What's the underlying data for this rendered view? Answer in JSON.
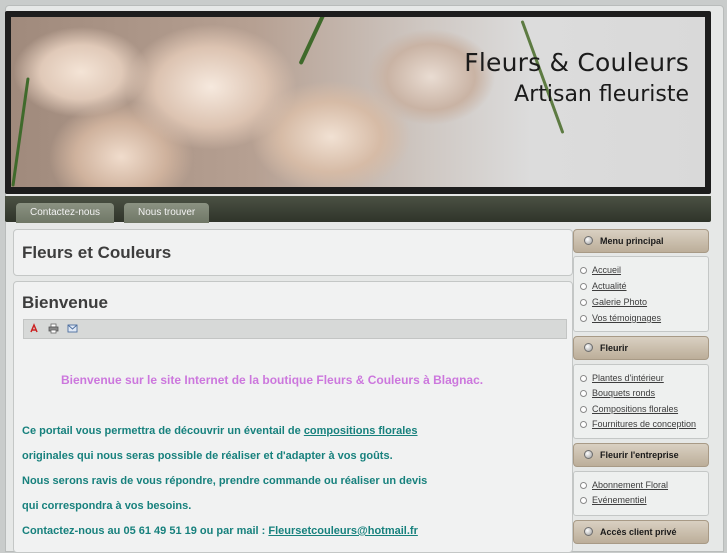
{
  "header": {
    "title": "Fleurs & Couleurs",
    "subtitle": "Artisan fleuriste"
  },
  "nav": {
    "tabs": [
      {
        "label": "Contactez-nous"
      },
      {
        "label": "Nous trouver"
      }
    ]
  },
  "site_title": "Fleurs et Couleurs",
  "article": {
    "title": "Bienvenue",
    "icons": [
      "pdf-icon",
      "print-icon",
      "email-icon"
    ],
    "welcome": "Bienvenue sur le site Internet de la boutique Fleurs & Couleurs à Blagnac.",
    "line1_pre": "Ce portail vous permettra de découvrir un éventail de ",
    "line1_link": "compositions florales",
    "line2": "originales qui nous seras possible de réaliser et d'adapter à vos goûts.",
    "line3": "Nous serons ravis de vous répondre, prendre commande ou réaliser un devis",
    "line4": "qui correspondra à vos besoins.",
    "line5_pre": "Contactez-nous au 05 61 49 51 19 ou par mail : ",
    "line5_link": "Fleursetcouleurs@hotmail.fr"
  },
  "sidebar": {
    "menu_principal": {
      "title": "Menu principal",
      "items": [
        "Accueil",
        "Actualité",
        "Galerie Photo",
        "Vos témoignages"
      ]
    },
    "fleurir": {
      "title": "Fleurir",
      "items": [
        "Plantes d'intérieur",
        "Bouquets ronds",
        "Compositions florales",
        "Fournitures de conception"
      ]
    },
    "fleurir_entreprise": {
      "title": "Fleurir l'entreprise",
      "items": [
        "Abonnement Floral",
        "Evénementiel"
      ]
    },
    "acces_client": {
      "title": "Accès client privé"
    }
  },
  "colors": {
    "accent_text": "#17817d",
    "welcome_text": "#cc77dd",
    "nav_bg": "#3a4034"
  }
}
